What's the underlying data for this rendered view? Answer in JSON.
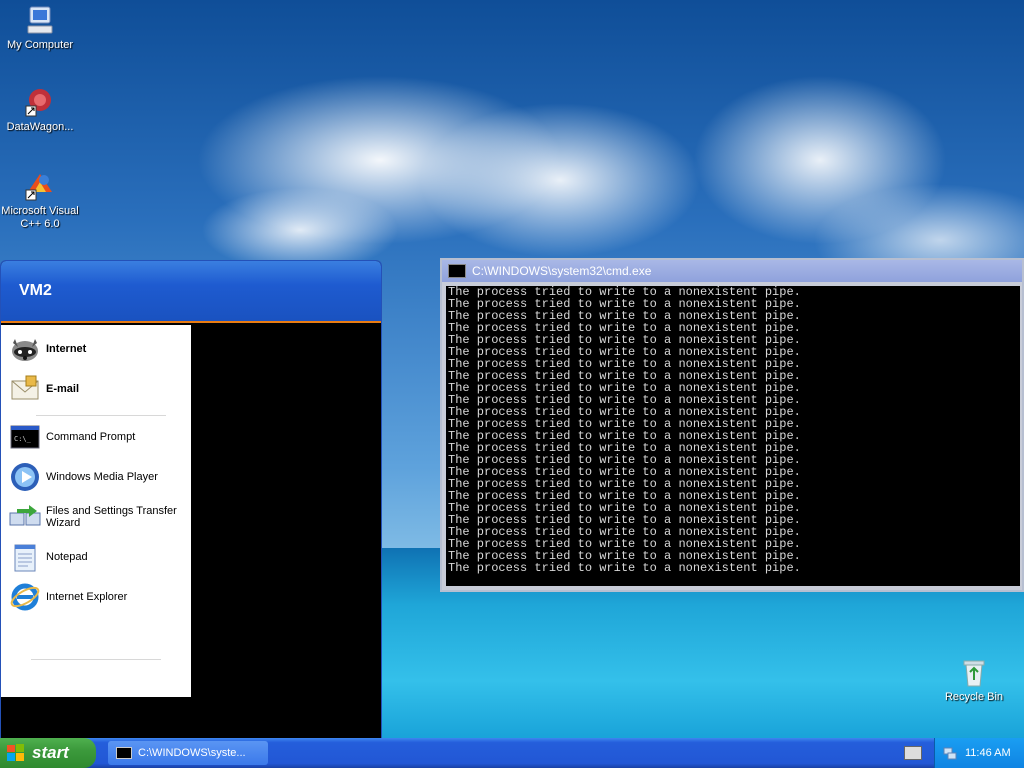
{
  "desktop": {
    "icons": [
      {
        "label": "My Computer"
      },
      {
        "label": "DataWagon..."
      },
      {
        "label": "Microsoft Visual C++ 6.0"
      },
      {
        "label": "Recycle Bin"
      }
    ]
  },
  "start_menu": {
    "user_name": "VM2",
    "pinned": [
      {
        "label": "Internet",
        "icon": "raccoon-browser-icon"
      },
      {
        "label": "E-mail",
        "icon": "email-icon"
      }
    ],
    "recent": [
      {
        "label": "Command Prompt",
        "icon": "command-prompt-icon"
      },
      {
        "label": "Windows Media Player",
        "icon": "media-player-icon"
      },
      {
        "label": "Files and Settings Transfer Wizard",
        "icon": "transfer-wizard-icon"
      },
      {
        "label": "Notepad",
        "icon": "notepad-icon"
      },
      {
        "label": "Internet Explorer",
        "icon": "internet-explorer-icon"
      }
    ]
  },
  "cmd_window": {
    "title": "C:\\WINDOWS\\system32\\cmd.exe",
    "lines": [
      "The process tried to write to a nonexistent pipe.",
      "The process tried to write to a nonexistent pipe.",
      "The process tried to write to a nonexistent pipe.",
      "The process tried to write to a nonexistent pipe.",
      "The process tried to write to a nonexistent pipe.",
      "The process tried to write to a nonexistent pipe.",
      "The process tried to write to a nonexistent pipe.",
      "The process tried to write to a nonexistent pipe.",
      "The process tried to write to a nonexistent pipe.",
      "The process tried to write to a nonexistent pipe.",
      "The process tried to write to a nonexistent pipe.",
      "The process tried to write to a nonexistent pipe.",
      "The process tried to write to a nonexistent pipe.",
      "The process tried to write to a nonexistent pipe.",
      "The process tried to write to a nonexistent pipe.",
      "The process tried to write to a nonexistent pipe.",
      "The process tried to write to a nonexistent pipe.",
      "The process tried to write to a nonexistent pipe.",
      "The process tried to write to a nonexistent pipe.",
      "The process tried to write to a nonexistent pipe.",
      "The process tried to write to a nonexistent pipe.",
      "The process tried to write to a nonexistent pipe.",
      "The process tried to write to a nonexistent pipe.",
      "The process tried to write to a nonexistent pipe."
    ]
  },
  "taskbar": {
    "start_label": "start",
    "task_label": "C:\\WINDOWS\\syste...",
    "clock": "11:46 AM"
  },
  "colors": {
    "taskbar_blue": "#245edb",
    "start_green": "#3c9a3c",
    "console_bg": "#000000",
    "console_text": "#d8d8d8",
    "start_menu_header": "#1e5bd0",
    "start_menu_separator_orange": "#e87b12"
  }
}
